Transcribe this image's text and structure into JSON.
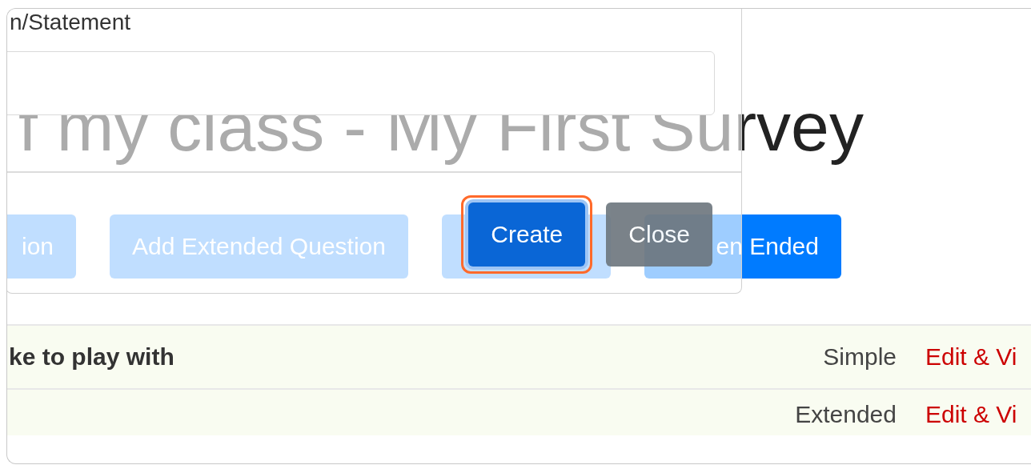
{
  "page": {
    "title": "f my class - My First Survey",
    "buttons": [
      {
        "label": "ion",
        "kind": "light"
      },
      {
        "label": "Add Extended Question",
        "kind": "light"
      },
      {
        "kind": "light"
      },
      {
        "label": "en Ended",
        "kind": "primary"
      }
    ],
    "rows": [
      {
        "question": "ke to play with",
        "type": "Simple",
        "action": "Edit & Vi"
      },
      {
        "type": "Extended",
        "action": "Edit & Vi"
      }
    ]
  },
  "modal": {
    "field_label": "n/Statement",
    "buttons": [
      {
        "label": "Create",
        "kind": "primary",
        "highlighted": true
      },
      {
        "label": "Close",
        "kind": "secondary",
        "highlighted": false
      }
    ]
  }
}
